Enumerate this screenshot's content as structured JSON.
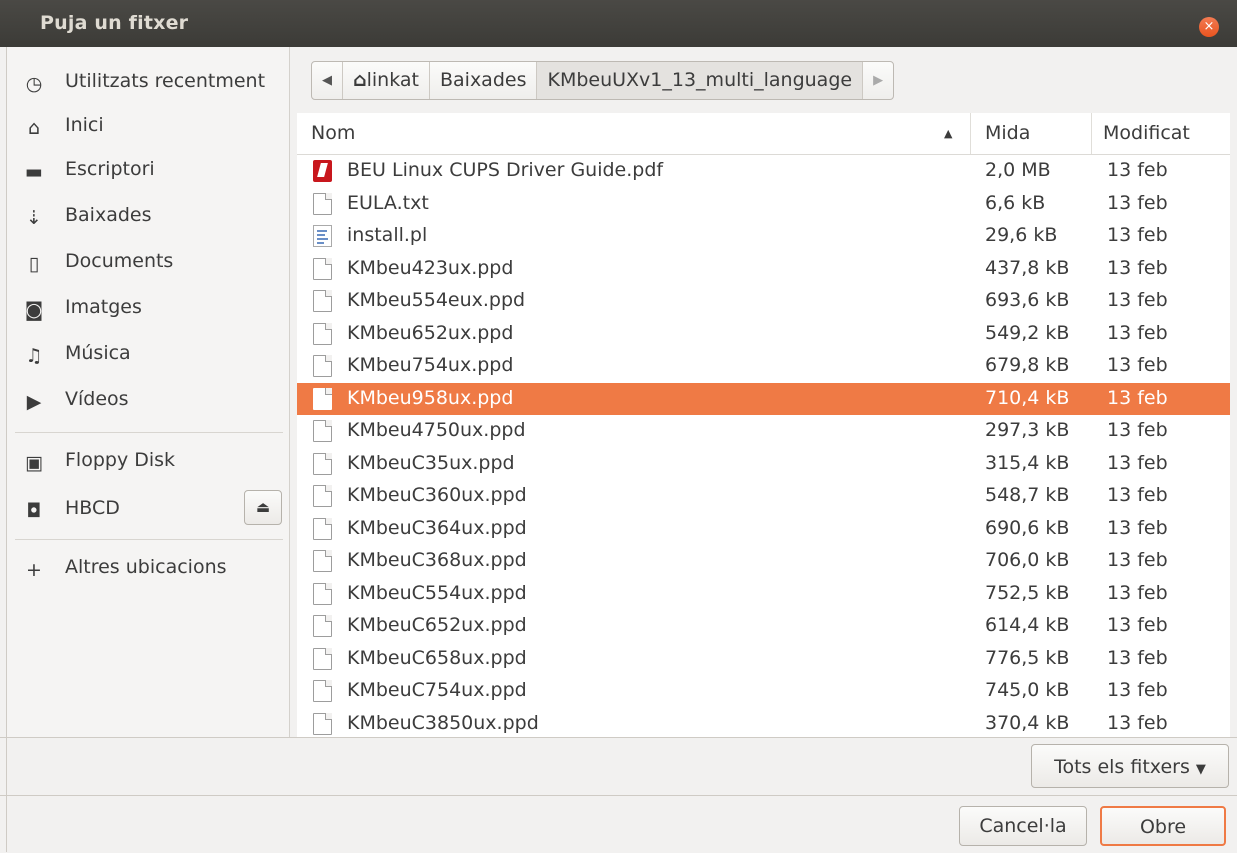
{
  "window": {
    "title": "Puja un fitxer",
    "close_glyph": "×"
  },
  "sidebar": {
    "items": [
      {
        "label": "Utilitzats recentment",
        "icon": "clock-icon",
        "glyph": "◷"
      },
      {
        "label": "Inici",
        "icon": "home-icon",
        "glyph": "⌂"
      },
      {
        "label": "Escriptori",
        "icon": "folder-icon",
        "glyph": "▬"
      },
      {
        "label": "Baixades",
        "icon": "download-icon",
        "glyph": "⇣"
      },
      {
        "label": "Documents",
        "icon": "document-icon",
        "glyph": "▯"
      },
      {
        "label": "Imatges",
        "icon": "camera-icon",
        "glyph": "◙"
      },
      {
        "label": "Música",
        "icon": "music-icon",
        "glyph": "♫"
      },
      {
        "label": "Vídeos",
        "icon": "video-icon",
        "glyph": "▶"
      }
    ],
    "devices": [
      {
        "label": "Floppy Disk",
        "icon": "floppy-icon",
        "glyph": "▣"
      },
      {
        "label": "HBCD",
        "icon": "drive-icon",
        "glyph": "◘"
      }
    ],
    "eject_glyph": "⏏",
    "other": {
      "label": "Altres ubicacions",
      "glyph": "+"
    }
  },
  "pathbar": {
    "back_glyph": "◀",
    "forward_glyph": "▶",
    "segments": [
      "linkat",
      "Baixades",
      "KMbeuUXv1_13_multi_language"
    ],
    "home_glyph": "⌂"
  },
  "columns": {
    "name": "Nom",
    "size": "Mida",
    "modified": "Modificat",
    "sort_glyph": "▲"
  },
  "files": [
    {
      "name": "BEU Linux CUPS Driver Guide.pdf",
      "size": "2,0 MB",
      "date": "13 feb",
      "type": "pdf"
    },
    {
      "name": "EULA.txt",
      "size": "6,6 kB",
      "date": "13 feb",
      "type": "doc"
    },
    {
      "name": "install.pl",
      "size": "29,6 kB",
      "date": "13 feb",
      "type": "script"
    },
    {
      "name": "KMbeu423ux.ppd",
      "size": "437,8 kB",
      "date": "13 feb",
      "type": "doc"
    },
    {
      "name": "KMbeu554eux.ppd",
      "size": "693,6 kB",
      "date": "13 feb",
      "type": "doc"
    },
    {
      "name": "KMbeu652ux.ppd",
      "size": "549,2 kB",
      "date": "13 feb",
      "type": "doc"
    },
    {
      "name": "KMbeu754ux.ppd",
      "size": "679,8 kB",
      "date": "13 feb",
      "type": "doc"
    },
    {
      "name": "KMbeu958ux.ppd",
      "size": "710,4 kB",
      "date": "13 feb",
      "type": "doc",
      "selected": true
    },
    {
      "name": "KMbeu4750ux.ppd",
      "size": "297,3 kB",
      "date": "13 feb",
      "type": "doc"
    },
    {
      "name": "KMbeuC35ux.ppd",
      "size": "315,4 kB",
      "date": "13 feb",
      "type": "doc"
    },
    {
      "name": "KMbeuC360ux.ppd",
      "size": "548,7 kB",
      "date": "13 feb",
      "type": "doc"
    },
    {
      "name": "KMbeuC364ux.ppd",
      "size": "690,6 kB",
      "date": "13 feb",
      "type": "doc"
    },
    {
      "name": "KMbeuC368ux.ppd",
      "size": "706,0 kB",
      "date": "13 feb",
      "type": "doc"
    },
    {
      "name": "KMbeuC554ux.ppd",
      "size": "752,5 kB",
      "date": "13 feb",
      "type": "doc"
    },
    {
      "name": "KMbeuC652ux.ppd",
      "size": "614,4 kB",
      "date": "13 feb",
      "type": "doc"
    },
    {
      "name": "KMbeuC658ux.ppd",
      "size": "776,5 kB",
      "date": "13 feb",
      "type": "doc"
    },
    {
      "name": "KMbeuC754ux.ppd",
      "size": "745,0 kB",
      "date": "13 feb",
      "type": "doc"
    },
    {
      "name": "KMbeuC3850ux.ppd",
      "size": "370,4 kB",
      "date": "13 feb",
      "type": "doc"
    }
  ],
  "filter": {
    "label": "Tots els fitxers",
    "arrow": "▼"
  },
  "buttons": {
    "cancel": "Cancel·la",
    "open": "Obre"
  },
  "colors": {
    "accent": "#ef7a45",
    "titlebar": "#3c3b37",
    "close": "#e9541f"
  }
}
